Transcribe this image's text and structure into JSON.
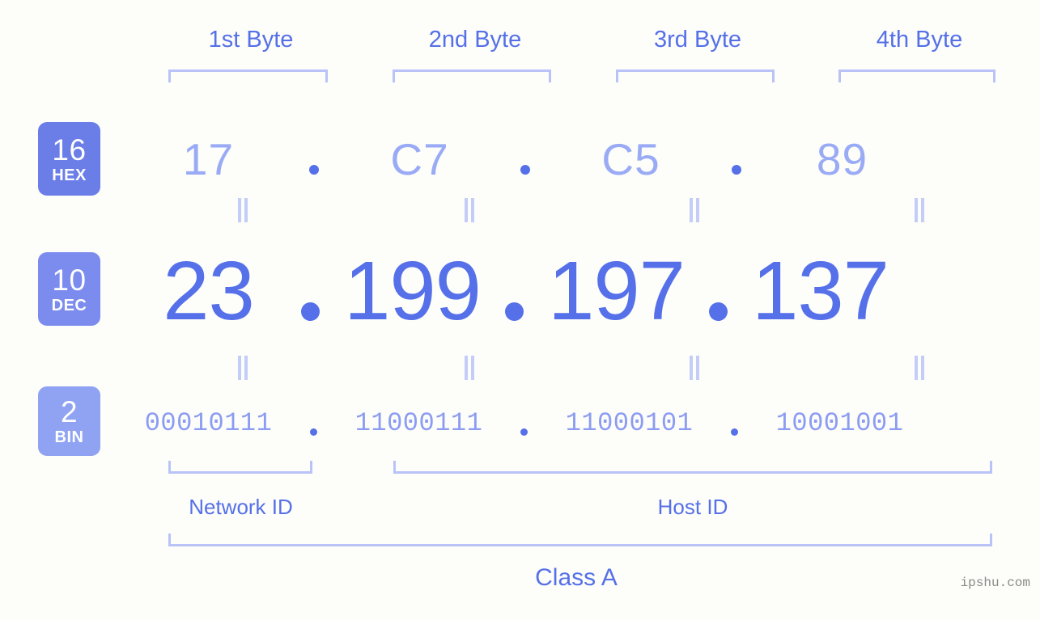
{
  "background_color": "#fdfdfa",
  "accent_strong": "#5570e8",
  "accent_mid": "#8fa3f2",
  "accent_light": "#b9c3f7",
  "byte_headers": [
    {
      "label": "1st Byte"
    },
    {
      "label": "2nd Byte"
    },
    {
      "label": "3rd Byte"
    },
    {
      "label": "4th Byte"
    }
  ],
  "rows": {
    "hex": {
      "badge_number": "16",
      "badge_base": "HEX",
      "badge_color": "#6b7ee8",
      "values": [
        "17",
        "C7",
        "C5",
        "89"
      ],
      "separator": "."
    },
    "dec": {
      "badge_number": "10",
      "badge_base": "DEC",
      "badge_color": "#7b8cee",
      "values": [
        "23",
        "199",
        "197",
        "137"
      ],
      "separator": "."
    },
    "bin": {
      "badge_number": "2",
      "badge_base": "BIN",
      "badge_color": "#8fa3f2",
      "values": [
        "00010111",
        "11000111",
        "11000101",
        "10001001"
      ],
      "separator": "."
    }
  },
  "equality_marker": "=",
  "segments": {
    "network_id_label": "Network ID",
    "host_id_label": "Host ID"
  },
  "class_label": "Class A",
  "watermark": "ipshu.com"
}
